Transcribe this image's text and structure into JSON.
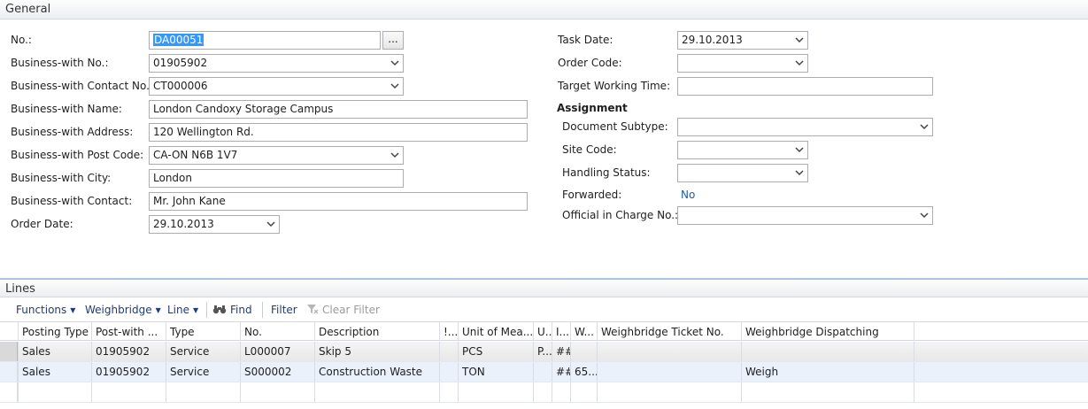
{
  "general": {
    "title": "General",
    "left_fields": [
      {
        "label": "No.:",
        "value": "DA00051"
      },
      {
        "label": "Business-with No.:",
        "value": "01905902"
      },
      {
        "label": "Business-with Contact No.:",
        "value": "CT000006"
      },
      {
        "label": "Business-with Name:",
        "value": "London Candoxy Storage Campus"
      },
      {
        "label": "Business-with Address:",
        "value": "120 Wellington Rd."
      },
      {
        "label": "Business-with Post Code:",
        "value": "CA-ON N6B 1V7"
      },
      {
        "label": "Business-with City:",
        "value": "London"
      },
      {
        "label": "Business-with Contact:",
        "value": "Mr. John Kane"
      },
      {
        "label": "Order Date:",
        "value": "29.10.2013"
      }
    ],
    "ellipsis_label": "...",
    "right_fields": [
      {
        "label": "Task Date:",
        "value": "29.10.2013"
      },
      {
        "label": "Order Code:",
        "value": ""
      },
      {
        "label": "Target Working Time:",
        "value": ""
      }
    ],
    "assignment": {
      "title": "Assignment",
      "fields": [
        {
          "label": "Document Subtype:",
          "value": ""
        },
        {
          "label": "Site Code:",
          "value": ""
        },
        {
          "label": "Handling Status:",
          "value": ""
        },
        {
          "label": "Forwarded:",
          "value": "No"
        },
        {
          "label": "Official in Charge No.:",
          "value": ""
        }
      ]
    }
  },
  "lines": {
    "title": "Lines",
    "toolbar": {
      "functions": "Functions",
      "weighbridge": "Weighbridge",
      "line": "Line",
      "find": "Find",
      "filter": "Filter",
      "clear_filter": "Clear Filter"
    },
    "columns": [
      "Posting Type",
      "Post-with ...",
      "Type",
      "No.",
      "Description",
      "!...",
      "Unit of Mea...",
      "U...",
      "I...",
      "W...",
      "Weighbridge Ticket No.",
      "Weighbridge Dispatching"
    ],
    "rows": [
      [
        "Sales",
        "01905902",
        "Service",
        "L000007",
        "Skip 5",
        "",
        "PCS",
        "P...",
        "##",
        "",
        "",
        ""
      ],
      [
        "Sales",
        "01905902",
        "Service",
        "S000002",
        "Construction Waste",
        "",
        "TON",
        "",
        "##",
        "65...",
        "",
        "Weigh"
      ]
    ]
  },
  "colors": {
    "selection": "#3399ff",
    "link": "#1a5cb0",
    "toolbar_text": "#1e3c78"
  }
}
